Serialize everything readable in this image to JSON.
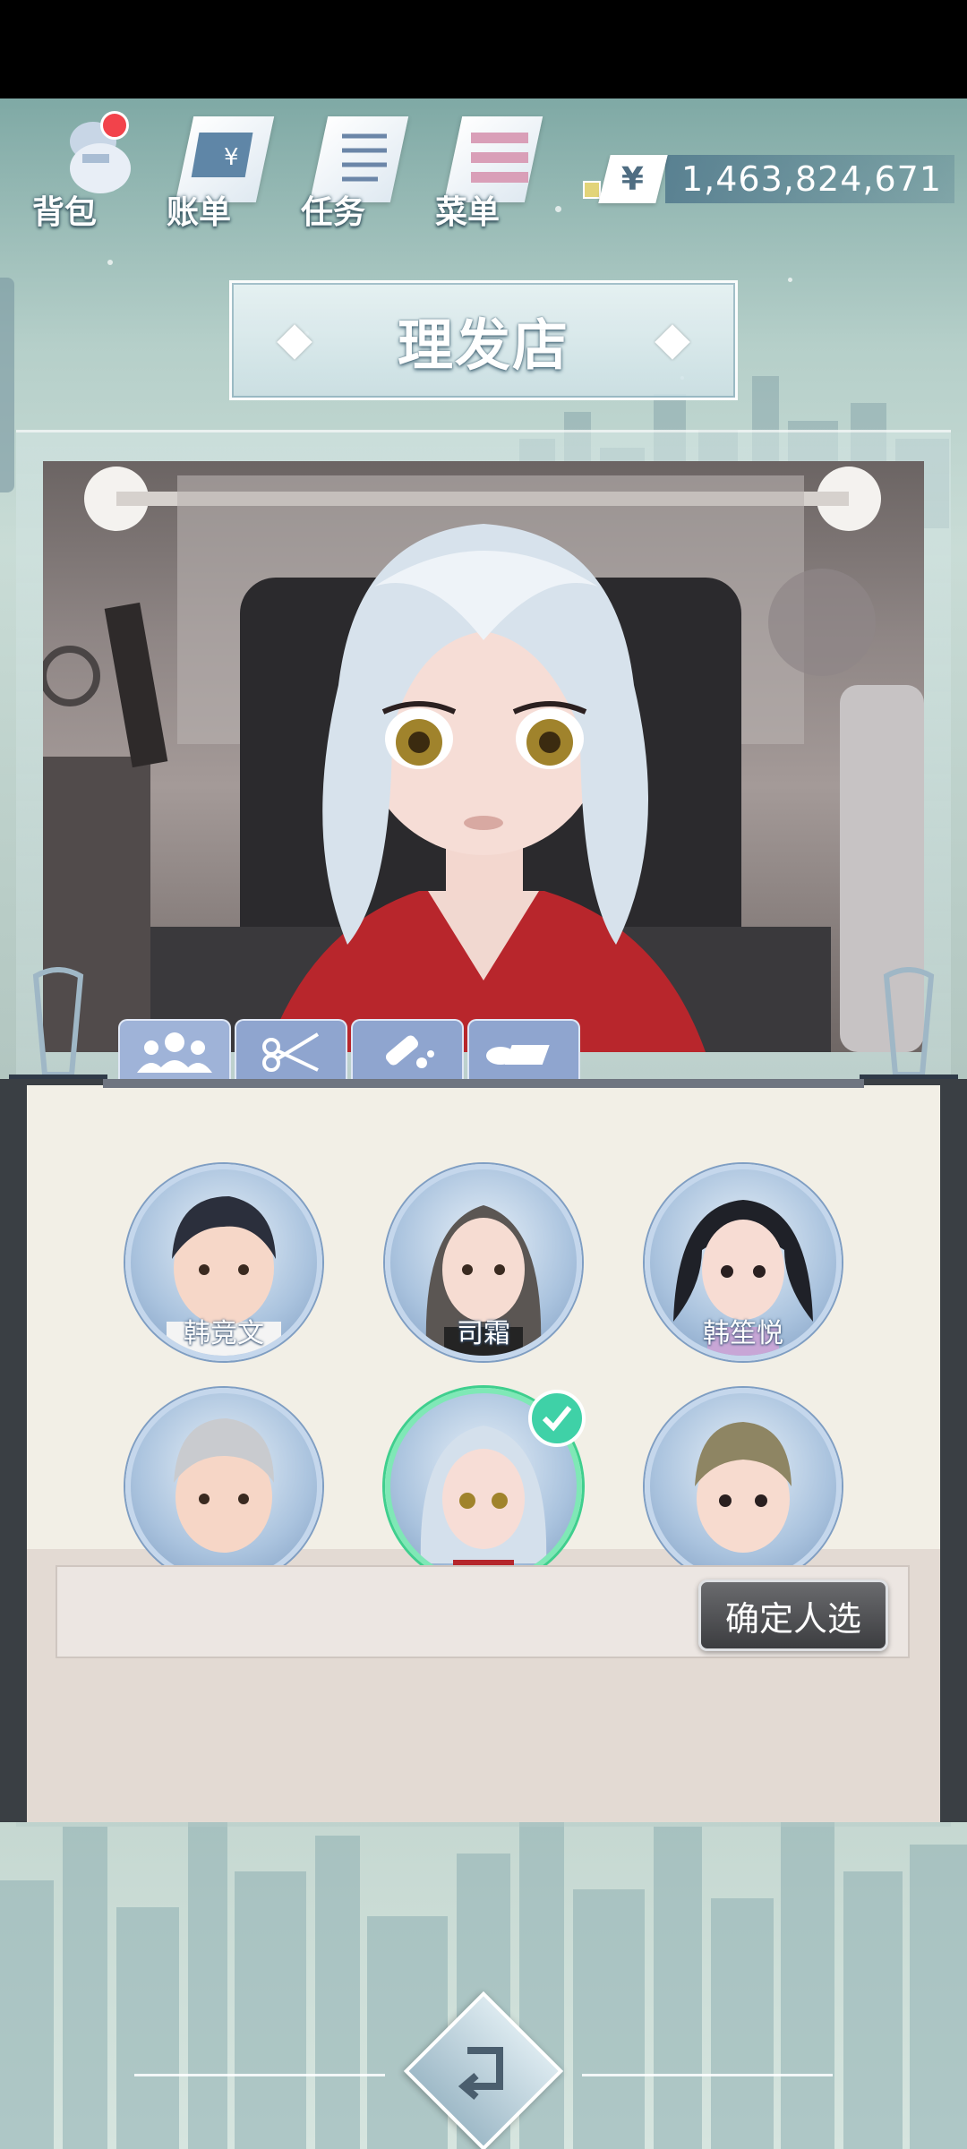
{
  "top_menu": {
    "items": [
      {
        "label": "背包",
        "icon": "bag-icon",
        "has_badge": true
      },
      {
        "label": "账单",
        "icon": "bill-icon"
      },
      {
        "label": "任务",
        "icon": "task-icon"
      },
      {
        "label": "菜单",
        "icon": "menu-icon"
      }
    ]
  },
  "currency": {
    "symbol": "¥",
    "amount": "1,463,824,671"
  },
  "title": "理发店",
  "tabs": [
    {
      "icon": "people-icon",
      "active": true
    },
    {
      "icon": "scissors-icon"
    },
    {
      "icon": "dye-icon"
    },
    {
      "icon": "accessory-icon"
    }
  ],
  "characters": [
    {
      "name": "韩竞文",
      "selected": false
    },
    {
      "name": "司霜",
      "selected": false
    },
    {
      "name": "韩笙悦",
      "selected": false
    },
    {
      "name": "",
      "selected": false
    },
    {
      "name": "",
      "selected": true
    },
    {
      "name": "",
      "selected": false
    }
  ],
  "confirm_label": "确定人选",
  "colors": {
    "accent": "#3fd1a7",
    "tab": "#8fa5cf",
    "badge": "#f2434b"
  }
}
